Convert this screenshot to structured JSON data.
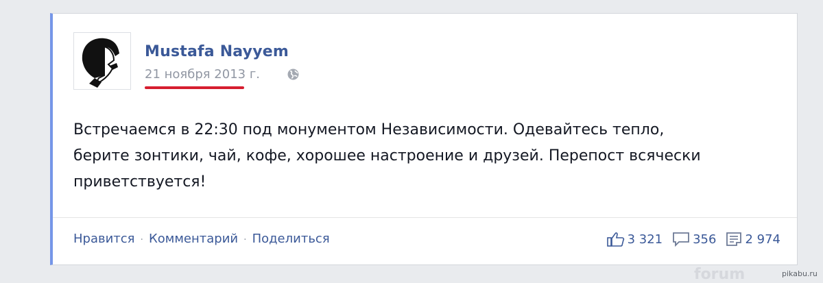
{
  "post": {
    "author": "Mustafa Nayyem",
    "date": "21 ноября 2013 г.",
    "privacy_icon": "globe-icon",
    "text": "Встречаемся в 22:30 под монументом Независимости. Одевайтесь тепло, берите зонтики, чай, кофе, хорошее настроение и друзей. Перепост всячески приветствуется!",
    "accent_color": "#7596e8",
    "highlight_color": "#d61e2f"
  },
  "actions": {
    "like": "Нравится",
    "separator": "·",
    "comment": "Комментарий",
    "share": "Поделиться"
  },
  "stats": {
    "likes": "3 321",
    "comments": "356",
    "shares": "2 974"
  },
  "watermarks": {
    "forum": "forum",
    "pikabu": "pikabu.ru"
  }
}
